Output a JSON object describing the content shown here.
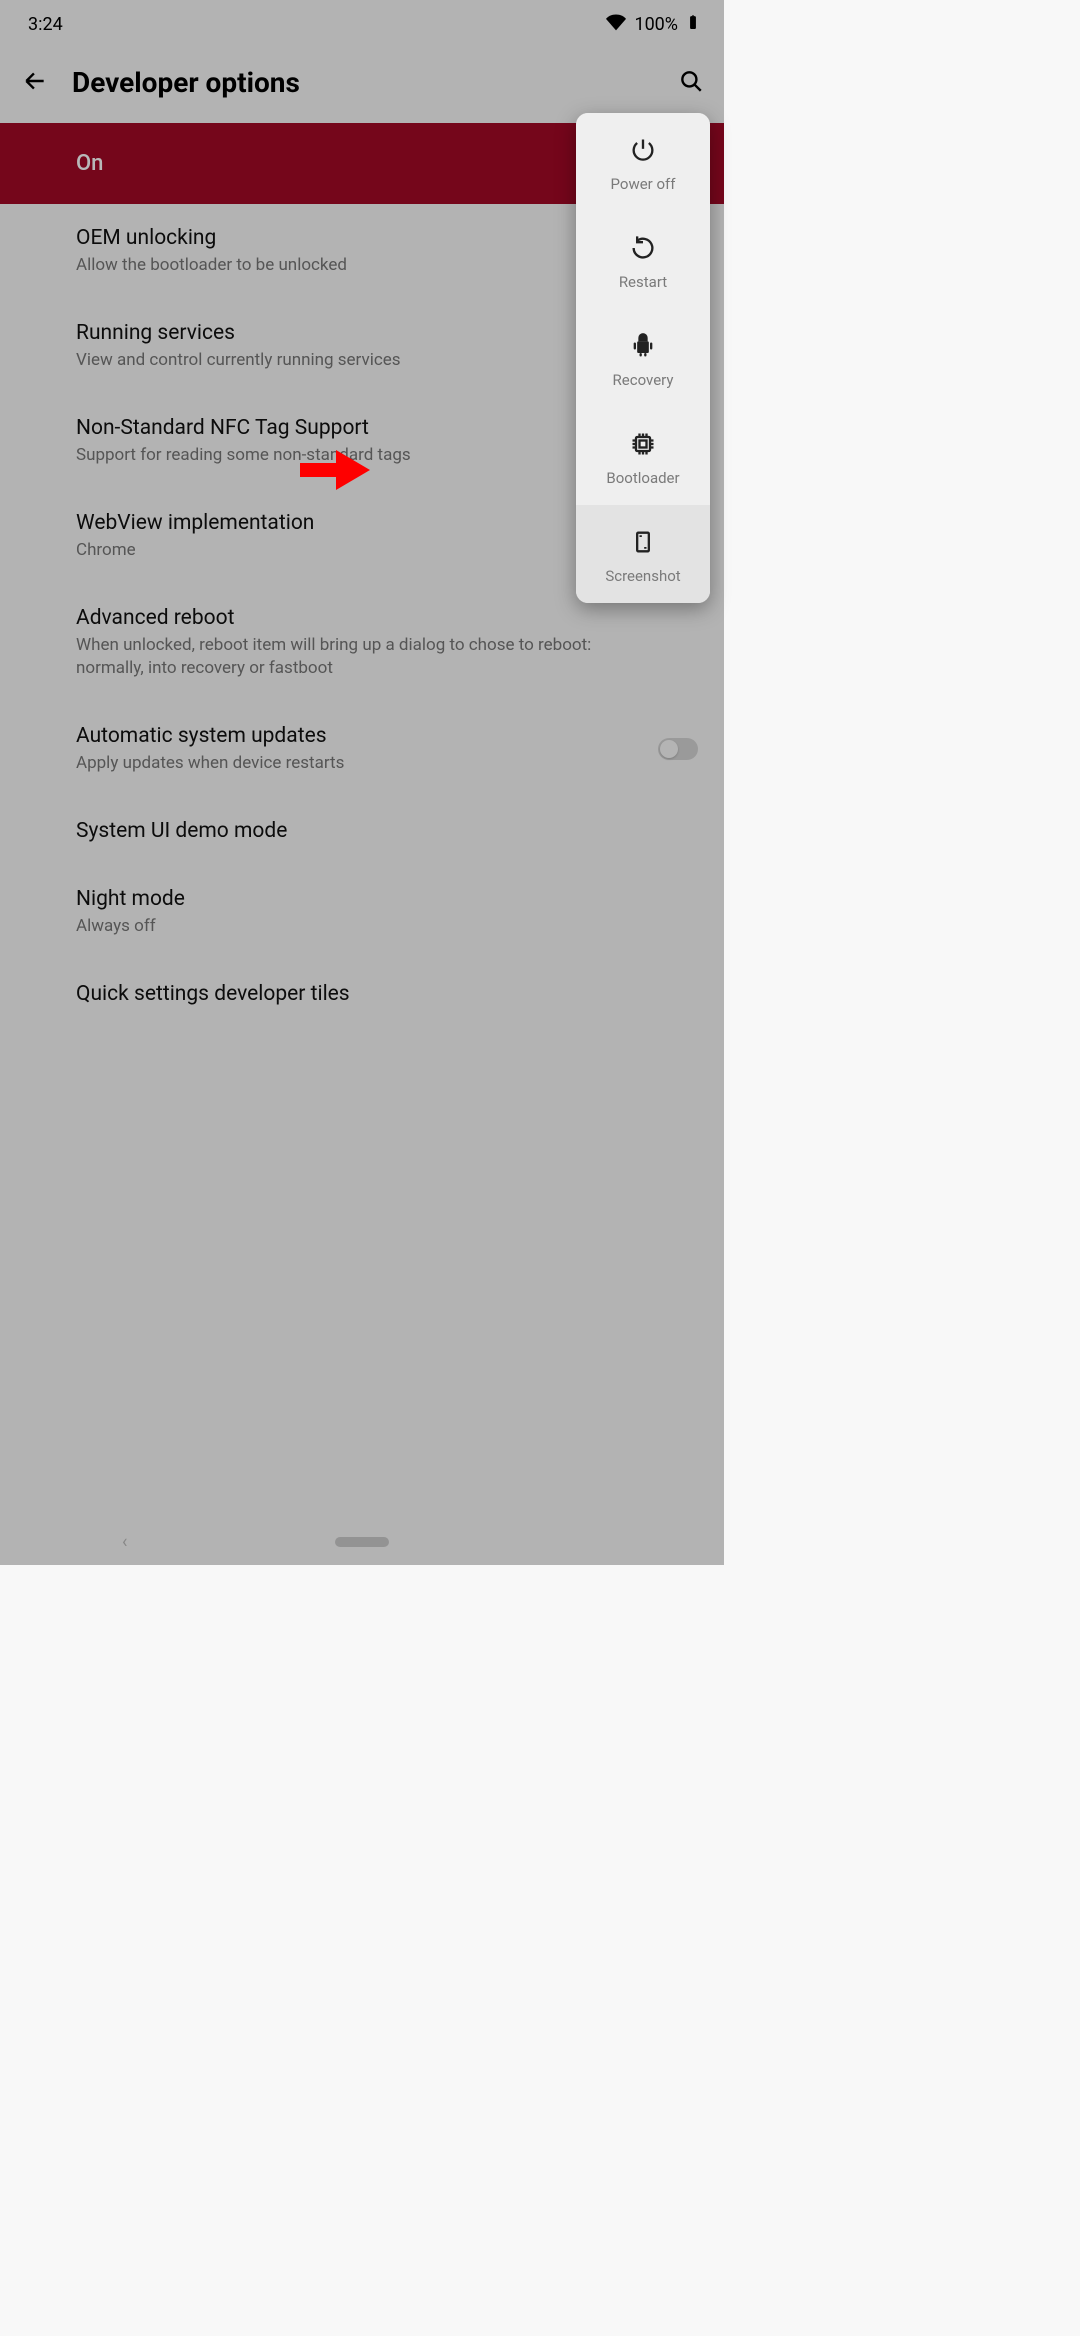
{
  "status": {
    "time": "3:24",
    "battery_pct": "100%"
  },
  "header": {
    "title": "Developer options"
  },
  "master_toggle_label": "On",
  "settings": [
    {
      "title": "OEM unlocking",
      "sub": "Allow the bootloader to be unlocked"
    },
    {
      "title": "Running services",
      "sub": "View and control currently running services"
    },
    {
      "title": "Non-Standard NFC Tag Support",
      "sub": "Support for reading some non-standard tags"
    },
    {
      "title": "WebView implementation",
      "sub": "Chrome"
    },
    {
      "title": "Advanced reboot",
      "sub": "When unlocked, reboot item will bring up a dialog to chose to reboot: normally, into recovery or fastboot"
    },
    {
      "title": "Automatic system updates",
      "sub": "Apply updates when device restarts"
    },
    {
      "title": "System UI demo mode",
      "sub": ""
    },
    {
      "title": "Night mode",
      "sub": "Always off"
    },
    {
      "title": "Quick settings developer tiles",
      "sub": ""
    }
  ],
  "power_menu": [
    {
      "label": "Power off"
    },
    {
      "label": "Restart"
    },
    {
      "label": "Recovery"
    },
    {
      "label": "Bootloader"
    },
    {
      "label": "Screenshot"
    }
  ]
}
